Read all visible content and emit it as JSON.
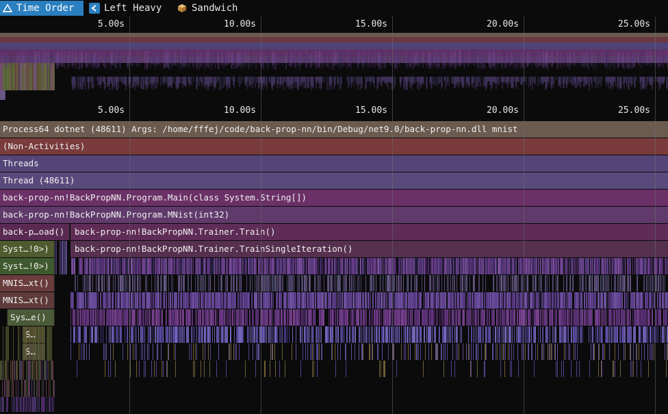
{
  "toolbar": {
    "tabs": [
      {
        "label": "Time Order",
        "icon": "time-order-icon",
        "active": true
      },
      {
        "label": "Left Heavy",
        "icon": "left-heavy-icon",
        "active": false
      },
      {
        "label": "Sandwich",
        "icon": "sandwich-icon",
        "active": false
      }
    ]
  },
  "axis": {
    "ticks": [
      "5.00s",
      "10.00s",
      "15.00s",
      "20.00s",
      "25.00s"
    ]
  },
  "flame": {
    "rows": [
      "Process64 dotnet (48611) Args: /home/fffej/code/back-prop-nn/bin/Debug/net9.0/back-prop-nn.dll mnist",
      "(Non-Activities)",
      "Threads",
      "Thread (48611)",
      "back-prop-nn!BackPropNN.Program.Main(class System.String[])",
      "back-prop-nn!BackPropNN.Program.MNist(int32)"
    ],
    "row7": {
      "left": "back-p…oad()",
      "right": "back-prop-nn!BackPropNN.Trainer.Train()"
    },
    "row8": {
      "left": "Syst…!0>)",
      "right": "back-prop-nn!BackPropNN.Trainer.TrainSingleIteration()"
    },
    "row9": {
      "left": "Syst…!0>)"
    },
    "row10": {
      "left": "MNIS…xt()"
    },
    "row11": {
      "left": "MNIS…xt()"
    },
    "row12": {
      "left": "Sys…e()"
    },
    "row13": {
      "left": "S…"
    },
    "row14": {
      "left": "S…"
    }
  },
  "colors": {
    "active_tab": "#2a7fc0",
    "process": "#6b5a4e",
    "non_activities": "#7a3b3c",
    "threads": "#544579",
    "thread": "#5a4a7c",
    "main": "#6b3167",
    "mnist": "#5f3a6a",
    "train": "#5e2c56"
  }
}
